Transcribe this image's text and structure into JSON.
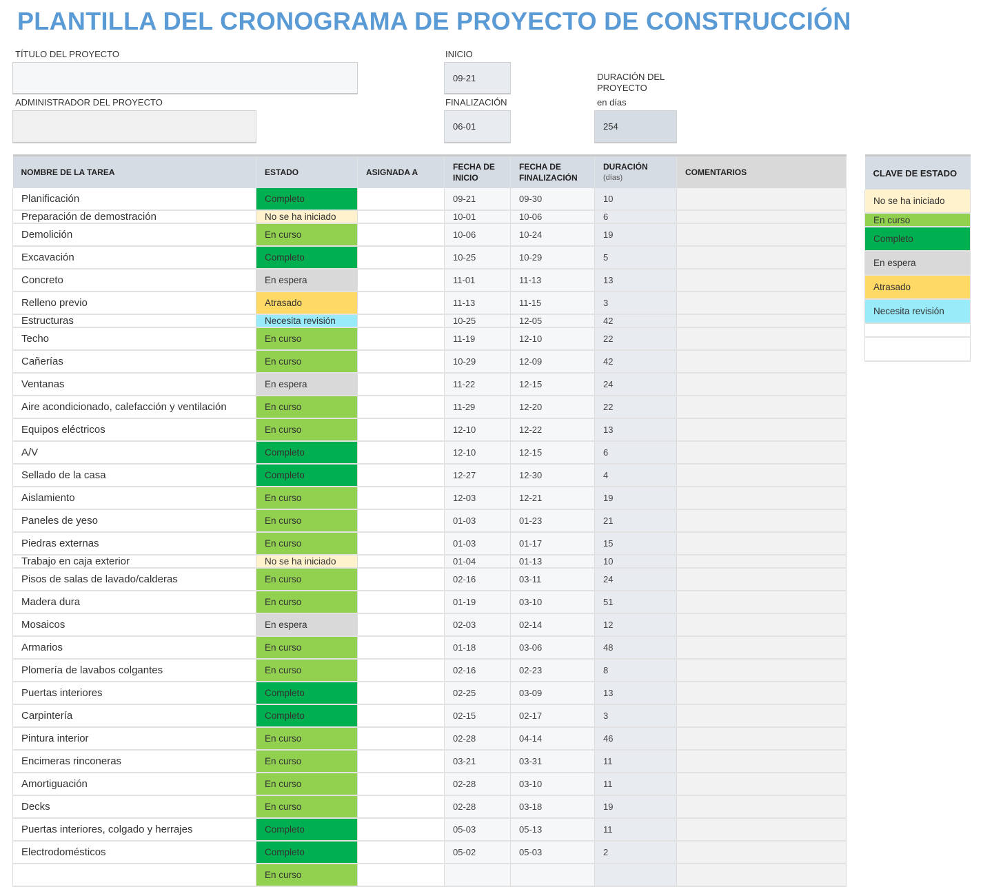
{
  "title": "PLANTILLA DEL CRONOGRAMA DE PROYECTO DE CONSTRUCCIÓN",
  "project": {
    "title_label": "TÍTULO DEL PROYECTO",
    "title_value": "",
    "manager_label": "ADMINISTRADOR DEL PROYECTO",
    "manager_value": "",
    "start_label": "INICIO",
    "start_value": "09-21",
    "end_label": "FINALIZACIÓN",
    "end_value": "06-01",
    "duration_label": "DURACIÓN DEL PROYECTO",
    "duration_unit": "en días",
    "duration_value": "254"
  },
  "table": {
    "headers": {
      "name": "NOMBRE DE LA TAREA",
      "status": "ESTADO",
      "assigned": "ASIGNADA A",
      "start": "FECHA DE INICIO",
      "end": "FECHA DE FINALIZACIÓN",
      "duration": "DURACIÓN",
      "duration_sub": "(días)",
      "comments": "COMENTARIOS"
    },
    "rows": [
      {
        "name": "Planificación",
        "status": "Completo",
        "assigned": "",
        "start": "09-21",
        "end": "09-30",
        "duration": "10",
        "comments": "",
        "size": "tall"
      },
      {
        "name": "Preparación de demostración",
        "status": "No se ha iniciado",
        "assigned": "",
        "start": "10-01",
        "end": "10-06",
        "duration": "6",
        "comments": "",
        "size": "short"
      },
      {
        "name": "Demolición",
        "status": "En curso",
        "assigned": "",
        "start": "10-06",
        "end": "10-24",
        "duration": "19",
        "comments": "",
        "size": "tall"
      },
      {
        "name": "Excavación",
        "status": "Completo",
        "assigned": "",
        "start": "10-25",
        "end": "10-29",
        "duration": "5",
        "comments": "",
        "size": "tall"
      },
      {
        "name": "Concreto",
        "status": "En espera",
        "assigned": "",
        "start": "11-01",
        "end": "11-13",
        "duration": "13",
        "comments": "",
        "size": "tall"
      },
      {
        "name": "Relleno previo",
        "status": "Atrasado",
        "assigned": "",
        "start": "11-13",
        "end": "11-15",
        "duration": "3",
        "comments": "",
        "size": "tall"
      },
      {
        "name": "Estructuras",
        "status": "Necesita revisión",
        "assigned": "",
        "start": "10-25",
        "end": "12-05",
        "duration": "42",
        "comments": "",
        "size": "short"
      },
      {
        "name": "Techo",
        "status": "En curso",
        "assigned": "",
        "start": "11-19",
        "end": "12-10",
        "duration": "22",
        "comments": "",
        "size": "tall"
      },
      {
        "name": "Cañerías",
        "status": "En curso",
        "assigned": "",
        "start": "10-29",
        "end": "12-09",
        "duration": "42",
        "comments": "",
        "size": "tall"
      },
      {
        "name": "Ventanas",
        "status": "En espera",
        "assigned": "",
        "start": "11-22",
        "end": "12-15",
        "duration": "24",
        "comments": "",
        "size": "tall"
      },
      {
        "name": "Aire acondicionado, calefacción y ventilación",
        "status": "En curso",
        "assigned": "",
        "start": "11-29",
        "end": "12-20",
        "duration": "22",
        "comments": "",
        "size": "tall"
      },
      {
        "name": "Equipos eléctricos",
        "status": "En curso",
        "assigned": "",
        "start": "12-10",
        "end": "12-22",
        "duration": "13",
        "comments": "",
        "size": "tall"
      },
      {
        "name": "A/V",
        "status": "Completo",
        "assigned": "",
        "start": "12-10",
        "end": "12-15",
        "duration": "6",
        "comments": "",
        "size": "tall"
      },
      {
        "name": "Sellado de la casa",
        "status": "Completo",
        "assigned": "",
        "start": "12-27",
        "end": "12-30",
        "duration": "4",
        "comments": "",
        "size": "tall"
      },
      {
        "name": "Aislamiento",
        "status": "En curso",
        "assigned": "",
        "start": "12-03",
        "end": "12-21",
        "duration": "19",
        "comments": "",
        "size": "tall"
      },
      {
        "name": "Paneles de yeso",
        "status": "En curso",
        "assigned": "",
        "start": "01-03",
        "end": "01-23",
        "duration": "21",
        "comments": "",
        "size": "tall"
      },
      {
        "name": "Piedras externas",
        "status": "En curso",
        "assigned": "",
        "start": "01-03",
        "end": "01-17",
        "duration": "15",
        "comments": "",
        "size": "tall"
      },
      {
        "name": "Trabajo en caja exterior",
        "status": "No se ha iniciado",
        "assigned": "",
        "start": "01-04",
        "end": "01-13",
        "duration": "10",
        "comments": "",
        "size": "short"
      },
      {
        "name": "Pisos de salas de lavado/calderas",
        "status": "En curso",
        "assigned": "",
        "start": "02-16",
        "end": "03-11",
        "duration": "24",
        "comments": "",
        "size": "tall"
      },
      {
        "name": "Madera dura",
        "status": "En curso",
        "assigned": "",
        "start": "01-19",
        "end": "03-10",
        "duration": "51",
        "comments": "",
        "size": "tall"
      },
      {
        "name": "Mosaicos",
        "status": "En espera",
        "assigned": "",
        "start": "02-03",
        "end": "02-14",
        "duration": "12",
        "comments": "",
        "size": "tall"
      },
      {
        "name": "Armarios",
        "status": "En curso",
        "assigned": "",
        "start": "01-18",
        "end": "03-06",
        "duration": "48",
        "comments": "",
        "size": "tall"
      },
      {
        "name": "Plomería de lavabos colgantes",
        "status": "En curso",
        "assigned": "",
        "start": "02-16",
        "end": "02-23",
        "duration": "8",
        "comments": "",
        "size": "tall"
      },
      {
        "name": "Puertas interiores",
        "status": "Completo",
        "assigned": "",
        "start": "02-25",
        "end": "03-09",
        "duration": "13",
        "comments": "",
        "size": "tall"
      },
      {
        "name": "Carpintería",
        "status": "Completo",
        "assigned": "",
        "start": "02-15",
        "end": "02-17",
        "duration": "3",
        "comments": "",
        "size": "tall"
      },
      {
        "name": "Pintura interior",
        "status": "En curso",
        "assigned": "",
        "start": "02-28",
        "end": "04-14",
        "duration": "46",
        "comments": "",
        "size": "tall"
      },
      {
        "name": "Encimeras rinconeras",
        "status": "En curso",
        "assigned": "",
        "start": "03-21",
        "end": "03-31",
        "duration": "11",
        "comments": "",
        "size": "tall"
      },
      {
        "name": "Amortiguación",
        "status": "En curso",
        "assigned": "",
        "start": "02-28",
        "end": "03-10",
        "duration": "11",
        "comments": "",
        "size": "tall"
      },
      {
        "name": "Decks",
        "status": "En curso",
        "assigned": "",
        "start": "02-28",
        "end": "03-18",
        "duration": "19",
        "comments": "",
        "size": "tall"
      },
      {
        "name": "Puertas interiores, colgado y herrajes",
        "status": "Completo",
        "assigned": "",
        "start": "05-03",
        "end": "05-13",
        "duration": "11",
        "comments": "",
        "size": "tall"
      },
      {
        "name": "Electrodomésticos",
        "status": "Completo",
        "assigned": "",
        "start": "05-02",
        "end": "05-03",
        "duration": "2",
        "comments": "",
        "size": "tall"
      },
      {
        "name": "",
        "status": "En curso",
        "assigned": "",
        "start": "",
        "end": "",
        "duration": "",
        "comments": "",
        "size": "tall"
      }
    ]
  },
  "status_key": {
    "title": "CLAVE DE ESTADO",
    "items": [
      {
        "label": "No se ha iniciado",
        "size": "tall"
      },
      {
        "label": "En curso",
        "size": "short"
      },
      {
        "label": "Completo",
        "size": "tall"
      },
      {
        "label": "En espera",
        "size": "tall"
      },
      {
        "label": "Atrasado",
        "size": "tall"
      },
      {
        "label": "Necesita revisión",
        "size": "tall"
      },
      {
        "label": "",
        "size": "short"
      },
      {
        "label": "",
        "size": "tall"
      }
    ]
  },
  "status_colors": {
    "No se ha iniciado": "#fff2cc",
    "En curso": "#92d050",
    "Completo": "#00b050",
    "En espera": "#d9d9d9",
    "Atrasado": "#ffd966",
    "Necesita revisión": "#99ebf9",
    "": "#ffffff"
  }
}
